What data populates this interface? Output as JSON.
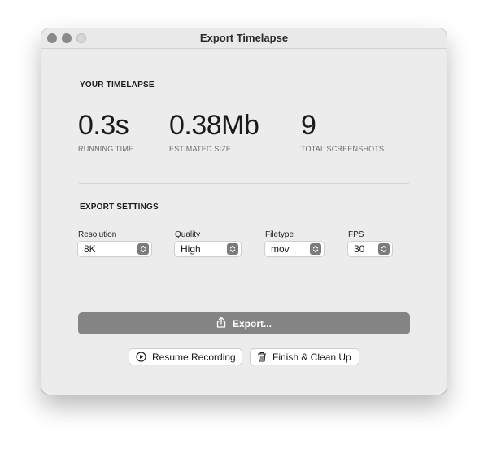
{
  "window": {
    "title": "Export Timelapse"
  },
  "timelapse": {
    "section_title": "YOUR TIMELAPSE",
    "stats": [
      {
        "value": "0.3s",
        "label": "RUNNING TIME"
      },
      {
        "value": "0.38Mb",
        "label": "ESTIMATED SIZE"
      },
      {
        "value": "9",
        "label": "TOTAL SCREENSHOTS"
      }
    ]
  },
  "settings": {
    "section_title": "EXPORT SETTINGS",
    "resolution": {
      "label": "Resolution",
      "value": "8K"
    },
    "quality": {
      "label": "Quality",
      "value": "High"
    },
    "filetype": {
      "label": "Filetype",
      "value": "mov"
    },
    "fps": {
      "label": "FPS",
      "value": "30"
    }
  },
  "actions": {
    "export_label": "Export...",
    "resume_label": "Resume Recording",
    "finish_label": "Finish & Clean Up"
  },
  "icons": {
    "export": "share-icon",
    "resume": "play-circle-icon",
    "finish": "trash-icon",
    "stepper": "chevron-up-down-icon"
  },
  "colors": {
    "export_button": "#848484",
    "window_bg": "#ececec"
  }
}
